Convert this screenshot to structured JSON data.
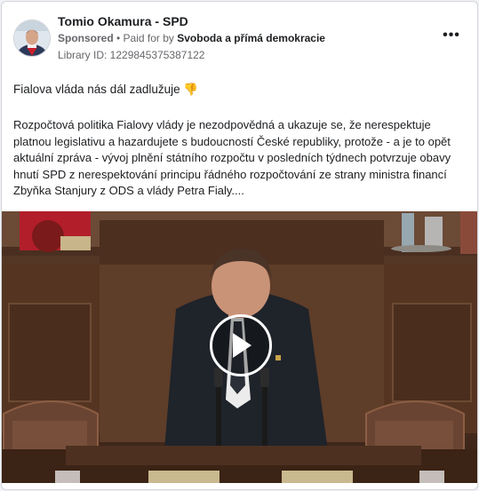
{
  "post": {
    "page_name": "Tomio Okamura - SPD",
    "sponsored_label": "Sponsored",
    "separator": " • ",
    "paid_for_by_label": "Paid for by ",
    "payer": "Svoboda a přímá demokracie",
    "library_id": "Library ID: 1229845375387122",
    "more_label": "•••",
    "headline": "Fialova vláda nás dál zadlužuje",
    "headline_emoji": "👎",
    "body": "Rozpočtová politika Fialovy vlády je nezodpovědná a ukazuje se, že nerespektuje platnou legislativu a hazardujete s budoucností České republiky, protože - a je to opět aktuální zpráva - vývoj plnění státního rozpočtu v posledních týdnech potvrzuje obavy hnutí SPD z nerespektování principu řádného rozpočtování ze strany ministra financí Zbyňka Stanjury z ODS a vlády Petra Fialy...."
  },
  "icons": {
    "more": "more-options-icon",
    "play": "play-icon",
    "avatar": "profile-avatar"
  },
  "colors": {
    "background": "#f0f2f5",
    "card": "#ffffff",
    "secondary_text": "#65676b",
    "primary_text": "#1c1e21",
    "emoji": "#e0a020"
  }
}
